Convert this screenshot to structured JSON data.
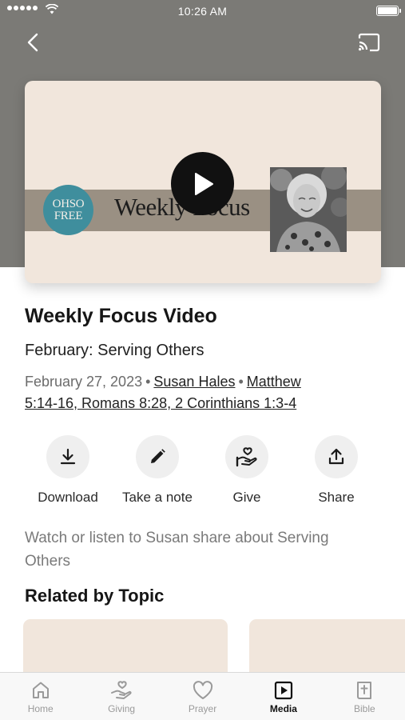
{
  "status_bar": {
    "time": "10:26 AM"
  },
  "video": {
    "thumbnail_logo_line1": "OHSO",
    "thumbnail_logo_line2": "FREE",
    "thumbnail_title": "Weekly Focus",
    "title": "Weekly Focus Video",
    "series": "February: Serving Others",
    "date": "February 27, 2023",
    "speaker": "Susan Hales",
    "scripture_line1": "Matthew",
    "scripture_line2": "5:14-16, Romans 8:28, 2 Corinthians 1:3-4",
    "description": "Watch or listen to Susan share about Serving Others"
  },
  "actions": [
    {
      "label": "Download",
      "icon": "download-icon"
    },
    {
      "label": "Take a note",
      "icon": "pencil-icon"
    },
    {
      "label": "Give",
      "icon": "give-icon"
    },
    {
      "label": "Share",
      "icon": "share-icon"
    }
  ],
  "related": {
    "heading": "Related by Topic"
  },
  "tab_bar": {
    "active": "Media",
    "items": [
      {
        "label": "Home",
        "icon": "home-icon"
      },
      {
        "label": "Giving",
        "icon": "giving-icon"
      },
      {
        "label": "Prayer",
        "icon": "heart-icon"
      },
      {
        "label": "Media",
        "icon": "play-icon"
      },
      {
        "label": "Bible",
        "icon": "bible-icon"
      }
    ]
  },
  "colors": {
    "hero_background": "#7b7a76",
    "thumbnail_background": "#f1e6dc",
    "logo_teal": "#3f8e9d",
    "action_circle": "#efefef"
  }
}
